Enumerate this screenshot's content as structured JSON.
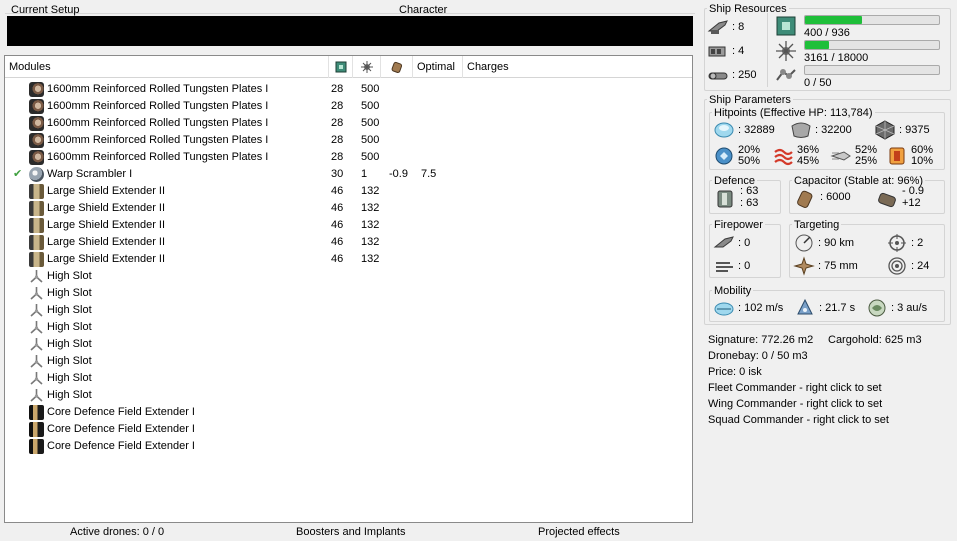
{
  "setup": {
    "current_setup_label": "Current Setup",
    "character_label": "Character"
  },
  "modules": {
    "headers": {
      "modules": "Modules",
      "optimal": "Optimal",
      "charges": "Charges"
    },
    "rows": [
      {
        "check": "",
        "icon": "armor-plate-icon",
        "name": "1600mm Reinforced Rolled Tungsten Plates I",
        "v1": "28",
        "v2": "500",
        "v3": "",
        "optimal": ""
      },
      {
        "check": "",
        "icon": "armor-plate-icon",
        "name": "1600mm Reinforced Rolled Tungsten Plates I",
        "v1": "28",
        "v2": "500",
        "v3": "",
        "optimal": ""
      },
      {
        "check": "",
        "icon": "armor-plate-icon",
        "name": "1600mm Reinforced Rolled Tungsten Plates I",
        "v1": "28",
        "v2": "500",
        "v3": "",
        "optimal": ""
      },
      {
        "check": "",
        "icon": "armor-plate-icon",
        "name": "1600mm Reinforced Rolled Tungsten Plates I",
        "v1": "28",
        "v2": "500",
        "v3": "",
        "optimal": ""
      },
      {
        "check": "",
        "icon": "armor-plate-icon",
        "name": "1600mm Reinforced Rolled Tungsten Plates I",
        "v1": "28",
        "v2": "500",
        "v3": "",
        "optimal": ""
      },
      {
        "check": "✔",
        "icon": "warp-scrambler-icon",
        "name": "Warp Scrambler I",
        "v1": "30",
        "v2": "1",
        "v3": "-0.9",
        "optimal": "7.5"
      },
      {
        "check": "",
        "icon": "shield-extender-icon",
        "name": "Large Shield Extender II",
        "v1": "46",
        "v2": "132",
        "v3": "",
        "optimal": ""
      },
      {
        "check": "",
        "icon": "shield-extender-icon",
        "name": "Large Shield Extender II",
        "v1": "46",
        "v2": "132",
        "v3": "",
        "optimal": ""
      },
      {
        "check": "",
        "icon": "shield-extender-icon",
        "name": "Large Shield Extender II",
        "v1": "46",
        "v2": "132",
        "v3": "",
        "optimal": ""
      },
      {
        "check": "",
        "icon": "shield-extender-icon",
        "name": "Large Shield Extender II",
        "v1": "46",
        "v2": "132",
        "v3": "",
        "optimal": ""
      },
      {
        "check": "",
        "icon": "shield-extender-icon",
        "name": "Large Shield Extender II",
        "v1": "46",
        "v2": "132",
        "v3": "",
        "optimal": ""
      },
      {
        "check": "",
        "icon": "high-slot-icon",
        "name": "High Slot",
        "v1": "",
        "v2": "",
        "v3": "",
        "optimal": ""
      },
      {
        "check": "",
        "icon": "high-slot-icon",
        "name": "High Slot",
        "v1": "",
        "v2": "",
        "v3": "",
        "optimal": ""
      },
      {
        "check": "",
        "icon": "high-slot-icon",
        "name": "High Slot",
        "v1": "",
        "v2": "",
        "v3": "",
        "optimal": ""
      },
      {
        "check": "",
        "icon": "high-slot-icon",
        "name": "High Slot",
        "v1": "",
        "v2": "",
        "v3": "",
        "optimal": ""
      },
      {
        "check": "",
        "icon": "high-slot-icon",
        "name": "High Slot",
        "v1": "",
        "v2": "",
        "v3": "",
        "optimal": ""
      },
      {
        "check": "",
        "icon": "high-slot-icon",
        "name": "High Slot",
        "v1": "",
        "v2": "",
        "v3": "",
        "optimal": ""
      },
      {
        "check": "",
        "icon": "high-slot-icon",
        "name": "High Slot",
        "v1": "",
        "v2": "",
        "v3": "",
        "optimal": ""
      },
      {
        "check": "",
        "icon": "high-slot-icon",
        "name": "High Slot",
        "v1": "",
        "v2": "",
        "v3": "",
        "optimal": ""
      },
      {
        "check": "",
        "icon": "core-defence-icon",
        "name": "Core Defence Field Extender I",
        "v1": "",
        "v2": "",
        "v3": "",
        "optimal": ""
      },
      {
        "check": "",
        "icon": "core-defence-icon",
        "name": "Core Defence Field Extender I",
        "v1": "",
        "v2": "",
        "v3": "",
        "optimal": ""
      },
      {
        "check": "",
        "icon": "core-defence-icon",
        "name": "Core Defence Field Extender I",
        "v1": "",
        "v2": "",
        "v3": "",
        "optimal": ""
      }
    ]
  },
  "bottom": {
    "active_drones": "Active drones: 0 / 0",
    "boosters": "Boosters and Implants",
    "projected": "Projected effects"
  },
  "resources": {
    "title": "Ship Resources",
    "turret_slots": ": 8",
    "launcher_slots": ": 4",
    "calibration": ": 250",
    "cpu": {
      "text": "400 / 936",
      "fraction": 0.427
    },
    "powergrid": {
      "text": "3161 / 18000",
      "fraction": 0.176
    },
    "drone_bandwidth": {
      "text": "0 / 50",
      "fraction": 0
    }
  },
  "parameters": {
    "title": "Ship Parameters",
    "hitpoints": {
      "title": "Hitpoints (Effective HP: 113,784)",
      "shield": ": 32889",
      "armor": ": 32200",
      "structure": ": 9375",
      "em": {
        "top": "20%",
        "bottom": "50%"
      },
      "thermal": {
        "top": "36%",
        "bottom": "45%"
      },
      "kinetic": {
        "top": "52%",
        "bottom": "25%"
      },
      "explosive": {
        "top": "60%",
        "bottom": "10%"
      }
    },
    "defence": {
      "title": "Defence",
      "a": ": 63",
      "b": ": 63"
    },
    "capacitor": {
      "title": "Capacitor (Stable at: 96%)",
      "amount": ": 6000",
      "delta_top": "- 0.9",
      "delta_bottom": "+12"
    },
    "firepower": {
      "title": "Firepower",
      "a": ": 0",
      "b": ": 0"
    },
    "targeting": {
      "title": "Targeting",
      "range": ": 90 km",
      "targets": ": 2",
      "resolution": ": 75 mm",
      "sensor": ": 24"
    },
    "mobility": {
      "title": "Mobility",
      "speed": ": 102 m/s",
      "align": ": 21.7 s",
      "warp": ": 3 au/s"
    }
  },
  "info": {
    "signature": "Signature: 772.26 m2",
    "cargohold": "Cargohold: 625 m3",
    "dronebay": "Dronebay: 0 / 50 m3",
    "price": "Price: 0 isk",
    "fleet": "Fleet Commander - right click to set",
    "wing": "Wing Commander - right click to set",
    "squad": "Squad Commander - right click to set"
  },
  "colors": {
    "bar_fill": "#1fbf3a",
    "check": "#3fa03f"
  }
}
